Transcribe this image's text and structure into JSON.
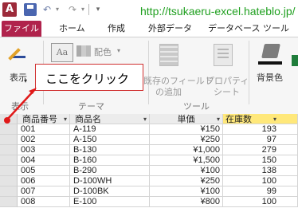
{
  "qat": {
    "app_icon": "A",
    "url": "http://tsukaeru-excel.hateblo.jp/"
  },
  "tabs": {
    "file": "ファイル",
    "home": "ホーム",
    "create": "作成",
    "external": "外部データ",
    "database": "データベース ツール"
  },
  "ribbon": {
    "display": "表示",
    "display_group": "表示",
    "theme_group": "テーマ",
    "color_label": "配色",
    "existing_fields": "既存のフィールド",
    "add_label": "の追加",
    "property": "プロパティ",
    "sheet": "シート",
    "tools_group": "ツール",
    "background_color": "背景色",
    "theme_icon_text": "Aa"
  },
  "callout": {
    "text": "ここをクリック"
  },
  "table": {
    "headers": [
      "商品番号",
      "商品名",
      "単価",
      "在庫数"
    ],
    "rows": [
      [
        "001",
        "A-119",
        "¥150",
        "193"
      ],
      [
        "002",
        "A-150",
        "¥250",
        "97"
      ],
      [
        "003",
        "B-130",
        "¥1,000",
        "279"
      ],
      [
        "004",
        "B-160",
        "¥1,500",
        "150"
      ],
      [
        "005",
        "B-290",
        "¥100",
        "138"
      ],
      [
        "006",
        "D-100WH",
        "¥250",
        "100"
      ],
      [
        "007",
        "D-100BK",
        "¥100",
        "99"
      ],
      [
        "008",
        "E-100",
        "¥800",
        "100"
      ]
    ]
  },
  "colors": {
    "file_tab": "#b0234c",
    "url": "#20a020",
    "callout_border": "#d03030",
    "active_column": "#ffe87a"
  },
  "icons": [
    "app-icon",
    "save-icon",
    "undo-icon",
    "redo-icon",
    "display-icon",
    "theme-icon",
    "color-icon",
    "field-icon",
    "property-icon",
    "background-color-icon"
  ]
}
